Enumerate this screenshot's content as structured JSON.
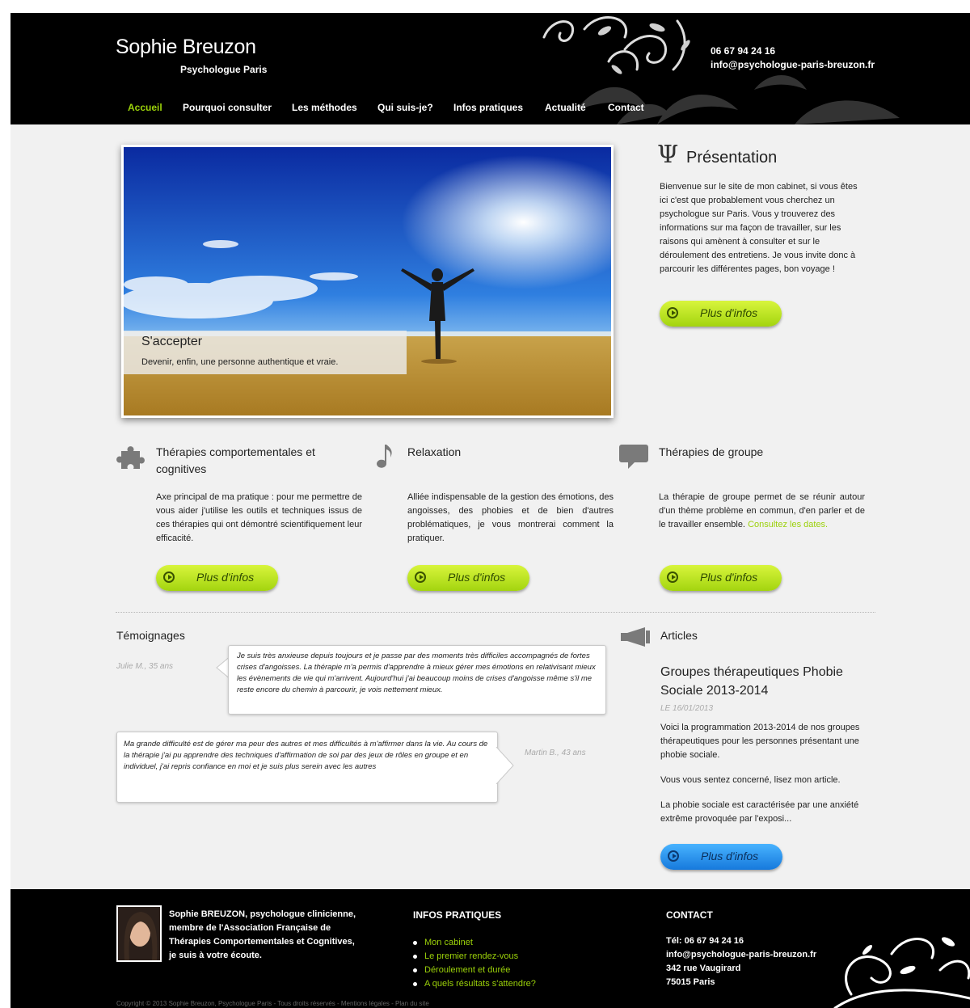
{
  "header": {
    "title": "Sophie Breuzon",
    "subtitle": "Psychologue Paris",
    "phone": "06 67 94 24 16",
    "email": "info@psychologue-paris-breuzon.fr"
  },
  "nav": {
    "items": [
      {
        "label": "Accueil",
        "active": true
      },
      {
        "label": "Pourquoi consulter"
      },
      {
        "label": "Les méthodes"
      },
      {
        "label": "Qui suis-je?"
      },
      {
        "label": "Infos pratiques"
      },
      {
        "label": "Actualité"
      },
      {
        "label": "Contact"
      }
    ]
  },
  "hero": {
    "caption_title": "S'accepter",
    "caption_text": "Devenir, enfin, une personne authentique et vraie."
  },
  "presentation": {
    "icon": "Ψ",
    "title": "Présentation",
    "text": "Bienvenue sur le site de mon cabinet, si vous êtes ici c'est que probablement vous cherchez un psychologue sur Paris. Vous y trouverez des informations sur ma façon de travailler, sur les raisons qui amènent à consulter et sur le déroulement des entretiens. Je vous invite donc à parcourir les différentes pages, bon voyage !",
    "button": "Plus d'infos"
  },
  "features": [
    {
      "icon": "puzzle-icon",
      "title": "Thérapies comportementales et cognitives",
      "text": "Axe principal de ma pratique : pour me permettre de vous aider j'utilise les outils et techniques issus de ces thérapies qui ont démontré scientifiquement leur efficacité.",
      "button": "Plus d'infos"
    },
    {
      "icon": "music-note-icon",
      "title": "Relaxation",
      "text": "Alliée indispensable de la gestion des émotions, des angoisses, des phobies et de bien d'autres problématiques, je vous montrerai comment la pratiquer.",
      "button": "Plus d'infos"
    },
    {
      "icon": "speech-bubble-icon",
      "title": "Thérapies de groupe",
      "text": "La thérapie de groupe permet de se réunir autour d'un thème problème en commun, d'en parler et de le travailler ensemble.",
      "link": "Consultez les dates.",
      "button": "Plus d'infos"
    }
  ],
  "testimonials": {
    "title": "Témoignages",
    "items": [
      {
        "author": "Julie M., 35 ans",
        "text": "Je suis très anxieuse depuis toujours et je passe par des moments très difficiles accompagnés de fortes crises d'angoisses. La thérapie m'a permis d'apprendre à mieux gérer mes émotions en relativisant mieux les évènements de vie qui m'arrivent. Aujourd'hui j'ai beaucoup moins de crises d'angoisse même s'il me reste encore du chemin à parcourir, je vois nettement mieux."
      },
      {
        "author": "Martin B., 43 ans",
        "text": "Ma grande difficulté est de gérer ma peur des autres et mes difficultés à m'affirmer dans la vie. Au cours de la thérapie j'ai pu apprendre des techniques d'affirmation de soi par des jeux de rôles en groupe et en individuel, j'ai repris confiance en moi et je suis plus serein avec les autres"
      }
    ]
  },
  "articles": {
    "icon": "megaphone-icon",
    "title": "Articles",
    "headline": "Groupes thérapeutiques Phobie Sociale 2013-2014",
    "date": "LE 16/01/2013",
    "paragraphs": [
      "Voici la programmation 2013-2014 de nos groupes thérapeutiques pour les personnes présentant une phobie sociale.",
      "Vous vous sentez concerné, lisez mon article.",
      "La phobie sociale est caractérisée par une anxiété extrême provoquée par l'exposi..."
    ],
    "button": "Plus d'infos"
  },
  "footer": {
    "bio": "Sophie BREUZON, psychologue clinicienne, membre de l'Association Française de Thérapies Comportementales et Cognitives, je suis à votre écoute.",
    "infos_title": "INFOS PRATIQUES",
    "infos_links": [
      "Mon cabinet",
      "Le premier rendez-vous",
      "Déroulement et durée",
      "A quels résultats s'attendre?"
    ],
    "contact_title": "CONTACT",
    "contact_phone": "Tél: 06 67 94 24 16",
    "contact_email": "info@psychologue-paris-breuzon.fr",
    "contact_street": "342 rue Vaugirard",
    "contact_city": "75015 Paris",
    "copyright": "Copyright © 2013 Sophie Breuzon, Psychologue Paris - Tous droits réservés - Mentions légales - Plan du site"
  },
  "colors": {
    "accent_green": "#9bd10a",
    "button_green": "#b8e31f",
    "button_blue": "#2a8ff0",
    "header_bg": "#000000",
    "page_bg": "#f1f1f1"
  }
}
